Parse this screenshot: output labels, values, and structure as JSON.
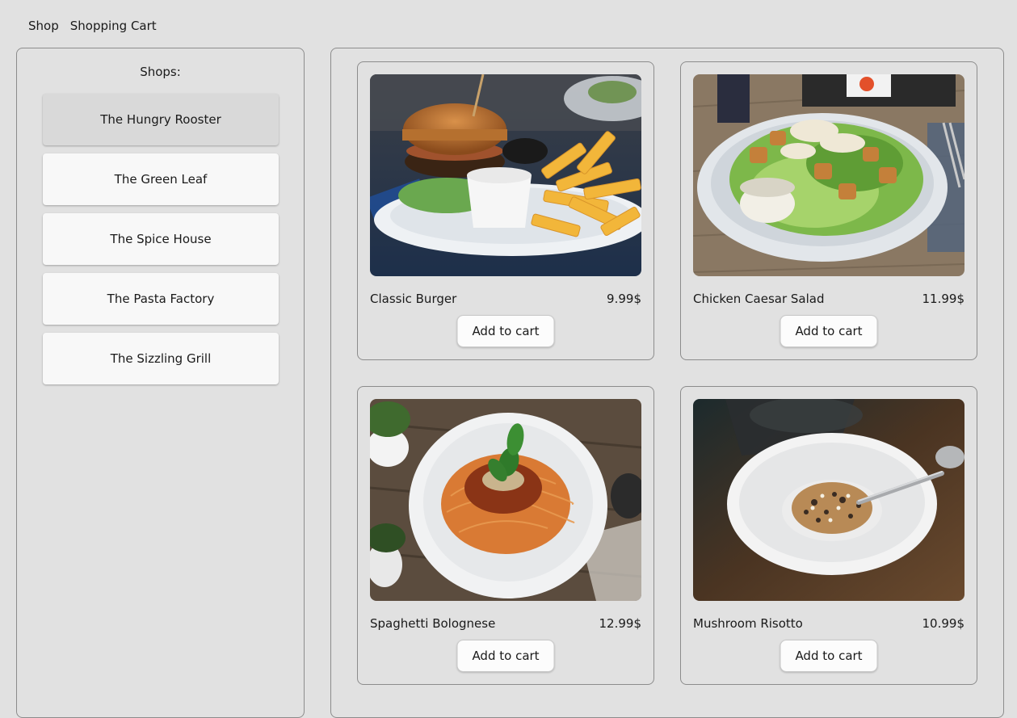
{
  "nav": {
    "shop": "Shop",
    "cart": "Shopping Cart"
  },
  "sidebar": {
    "title": "Shops:",
    "shops": [
      {
        "label": "The Hungry Rooster",
        "selected": true
      },
      {
        "label": "The Green Leaf",
        "selected": false
      },
      {
        "label": "The Spice House",
        "selected": false
      },
      {
        "label": "The Pasta Factory",
        "selected": false
      },
      {
        "label": "The Sizzling Grill",
        "selected": false
      }
    ]
  },
  "products": [
    {
      "name": "Classic Burger",
      "price": "9.99$",
      "button": "Add to cart",
      "image": "burger-photo"
    },
    {
      "name": "Chicken Caesar Salad",
      "price": "11.99$",
      "button": "Add to cart",
      "image": "salad-photo"
    },
    {
      "name": "Spaghetti Bolognese",
      "price": "12.99$",
      "button": "Add to cart",
      "image": "spaghetti-photo"
    },
    {
      "name": "Mushroom Risotto",
      "price": "10.99$",
      "button": "Add to cart",
      "image": "risotto-photo"
    }
  ],
  "colors": {
    "page_bg": "#e1e1e1",
    "border": "#8c8c8c",
    "button_bg": "#f8f8f8",
    "selected_bg": "#d9d9d9"
  }
}
